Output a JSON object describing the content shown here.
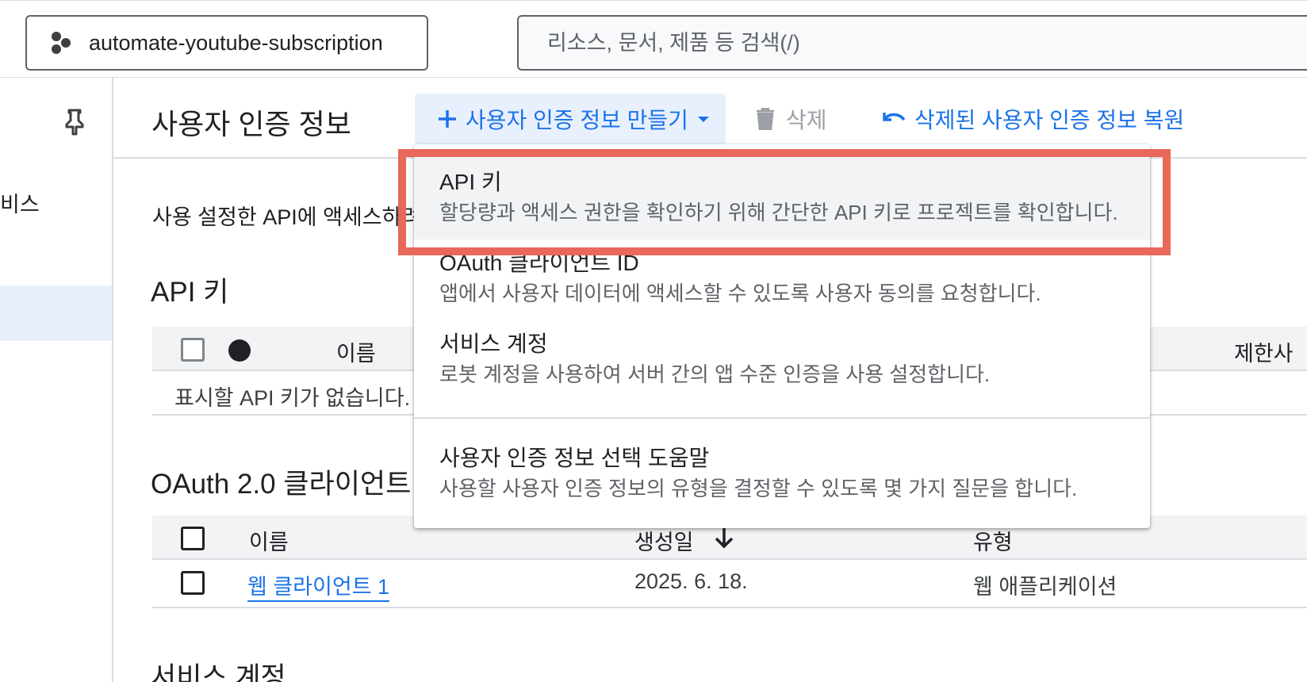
{
  "topbar": {
    "project_name": "automate-youtube-subscription",
    "project_icon": "project-hexagon-icon",
    "search_placeholder": "리소스, 문서, 제품 등 검색(/)"
  },
  "sidebar": {
    "pin_icon": "pin-icon",
    "item_partial": "비스"
  },
  "header": {
    "title": "사용자 인증 정보",
    "create_label": "사용자 인증 정보 만들기",
    "delete_label": "삭제",
    "restore_label": "삭제된 사용자 인증 정보 복원"
  },
  "intro_text": "사용 설정한 API에 액세스하려",
  "api_keys": {
    "title": "API 키",
    "col_name": "이름",
    "col_restrictions": "제한사",
    "empty_message": "표시할 API 키가 없습니다."
  },
  "oauth": {
    "title": "OAuth 2.0 클라이언트",
    "columns": {
      "name": "이름",
      "created": "생성일",
      "type": "유형"
    },
    "rows": [
      {
        "name": "웹 클라이언트 1",
        "created": "2025. 6. 18.",
        "type": "웹 애플리케이션"
      }
    ]
  },
  "service_accounts": {
    "title": "서비스 계정"
  },
  "menu": {
    "items": [
      {
        "title": "API 키",
        "desc": "할당량과 액세스 권한을 확인하기 위해 간단한 API 키로 프로젝트를 확인합니다."
      },
      {
        "title": "OAuth 클라이언트 ID",
        "desc": "앱에서 사용자 데이터에 액세스할 수 있도록 사용자 동의를 요청합니다."
      },
      {
        "title": "서비스 계정",
        "desc": "로봇 계정을 사용하여 서버 간의 앱 수준 인증을 사용 설정합니다."
      },
      {
        "title": "사용자 인증 정보 선택 도움말",
        "desc": "사용할 사용자 인증 정보의 유형을 결정할 수 있도록 몇 가지 질문을 합니다."
      }
    ]
  },
  "colors": {
    "accent": "#1a73e8",
    "highlight_border": "#e8685a",
    "active_bg": "#e8f0fe"
  }
}
